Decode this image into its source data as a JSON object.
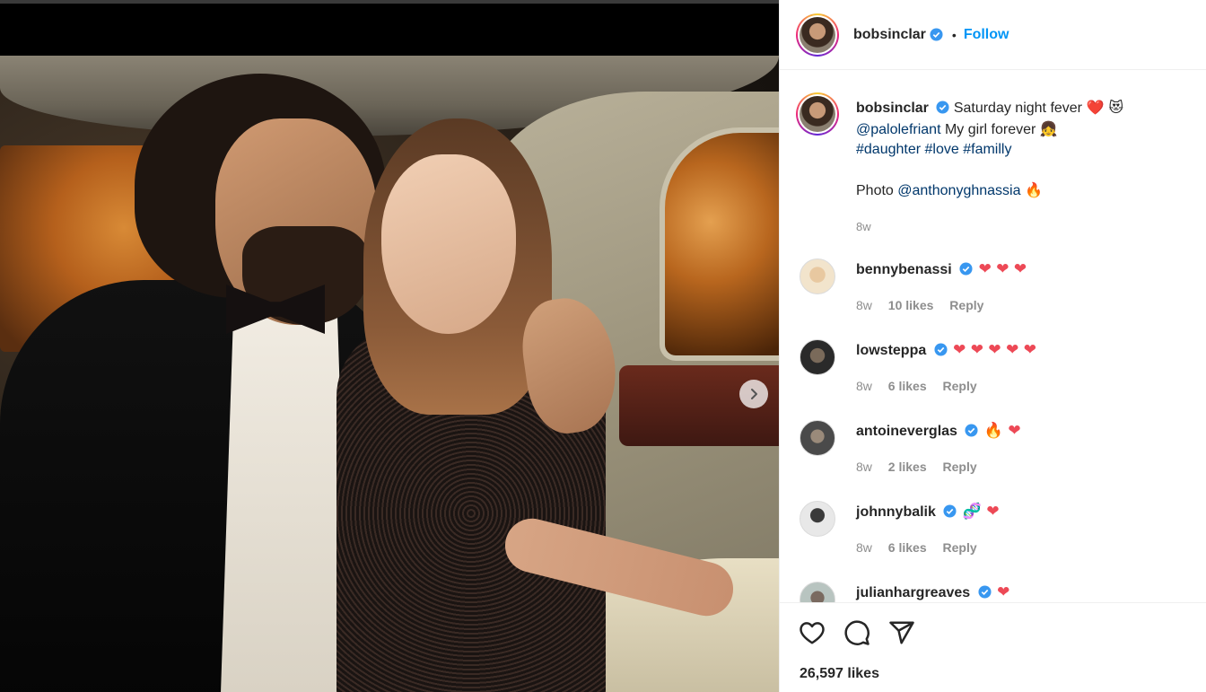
{
  "post": {
    "username": "bobsinclar",
    "follow_label": "Follow",
    "separator": "•"
  },
  "caption": {
    "username": "bobsinclar",
    "line1": "Saturday night fever",
    "line1_emojis": "❤️ 😻",
    "mention": "@palolefriant",
    "line2": "My girl forever",
    "line2_emoji": "👧",
    "hashtags": [
      "#daughter",
      "#love",
      "#familly"
    ],
    "photo_label": "Photo",
    "photo_mention": "@anthonyghnassia",
    "photo_emoji": "🔥",
    "time": "8w"
  },
  "comments": [
    {
      "username": "bennybenassi",
      "text": "❤ ❤ ❤",
      "time": "8w",
      "likes": "10 likes",
      "reply": "Reply",
      "avatar_color": "#f2e4cc"
    },
    {
      "username": "lowsteppa",
      "text": "❤ ❤ ❤ ❤ ❤",
      "time": "8w",
      "likes": "6 likes",
      "reply": "Reply",
      "avatar_color": "#2a2a2a"
    },
    {
      "username": "antoineverglas",
      "text": "🔥 ❤",
      "time": "8w",
      "likes": "2 likes",
      "reply": "Reply",
      "avatar_color": "#4a4a4a"
    },
    {
      "username": "johnnybalik",
      "text": "🧬 ❤",
      "time": "8w",
      "likes": "6 likes",
      "reply": "Reply",
      "avatar_color": "#d8d8d8"
    },
    {
      "username": "julianhargreaves",
      "text": "❤",
      "time": "",
      "likes": "",
      "reply": "",
      "avatar_color": "#b8c4c0"
    }
  ],
  "footer": {
    "likes": "26,597 likes"
  },
  "icons": [
    "chevron-right-icon",
    "verified-badge-icon",
    "heart-icon",
    "comment-icon",
    "share-icon"
  ],
  "colors": {
    "link": "#00376b",
    "follow": "#0095f6",
    "heart": "#ed4956",
    "verified": "#3897f0"
  }
}
